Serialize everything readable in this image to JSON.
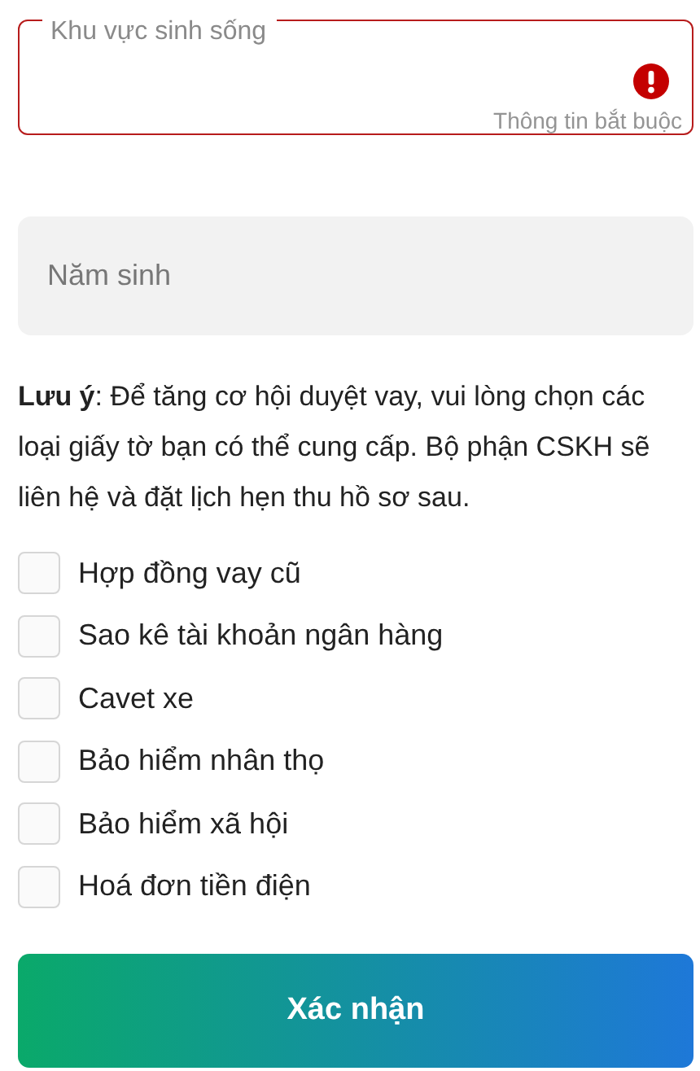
{
  "residence_field": {
    "label": "Khu vực sinh sống",
    "error": true,
    "helper": "Thông tin bắt buộc"
  },
  "birth_year_field": {
    "placeholder": "Năm sinh"
  },
  "note": "**Lưu ý**: Để tăng cơ hội duyệt vay, vui lòng chọn các loại giấy tờ bạn có thể cung cấp. Bộ phận CSKH sẽ liên hệ và đặt lịch hẹn thu hồ sơ sau.",
  "documents": [
    {
      "label": "Hợp đồng vay cũ",
      "checked": false
    },
    {
      "label": "Sao kê tài khoản ngân hàng",
      "checked": false
    },
    {
      "label": "Cavet xe",
      "checked": false
    },
    {
      "label": "Bảo hiểm nhân thọ",
      "checked": false
    },
    {
      "label": "Bảo hiểm xã hội",
      "checked": false
    },
    {
      "label": "Hoá đơn tiền điện",
      "checked": false
    }
  ],
  "confirm_button": "Xác nhận"
}
